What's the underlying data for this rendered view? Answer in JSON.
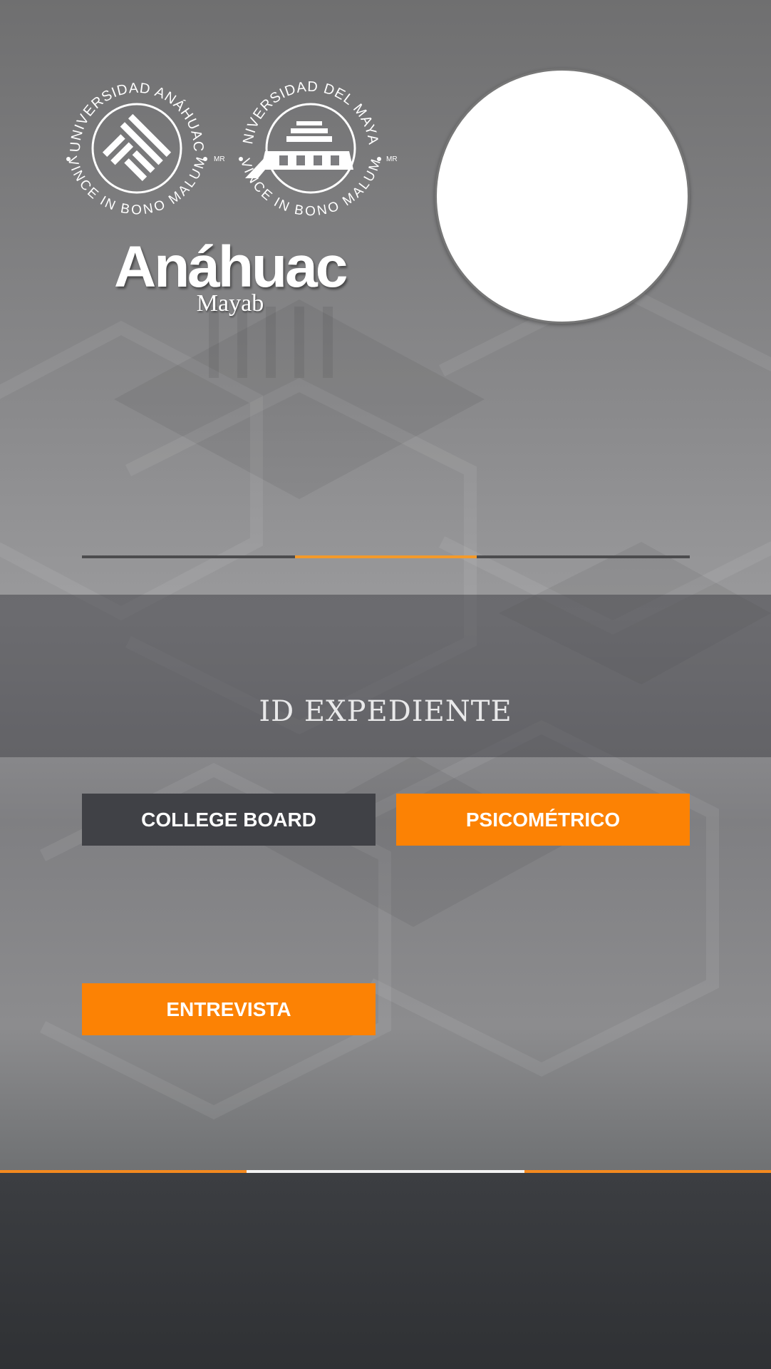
{
  "logos": {
    "seal_left": {
      "text_top": "UNIVERSIDAD ANÁHUAC",
      "text_bottom": "VINCE IN BONO MALUM",
      "mark": "MR",
      "icon": "anahuac-seal-icon"
    },
    "seal_right": {
      "text_top": "UNIVERSIDAD DEL MAYAB",
      "text_bottom": "VINCE IN BONO MALUM",
      "mark": "MR",
      "icon": "mayab-seal-icon"
    },
    "wordmark_main": "Anáhuac",
    "wordmark_sub": "Mayab"
  },
  "profile": {
    "avatar_icon": "avatar-placeholder"
  },
  "progress": {
    "segment_start": 0.35,
    "segment_end": 0.65,
    "track_color": "#4c4c4e",
    "fill_color": "#f49a2a"
  },
  "record": {
    "id_label": "ID EXPEDIENTE"
  },
  "actions": {
    "college_board": "COLLEGE BOARD",
    "psicometrico": "PSICOMÉTRICO",
    "entrevista": "ENTREVISTA"
  },
  "bottom_indicator": {
    "segment_start": 0.32,
    "segment_end": 0.68,
    "line_color": "#f58a1f",
    "active_color": "#f3f3f3"
  },
  "colors": {
    "accent": "#fc8204",
    "dark_button": "#404146"
  }
}
